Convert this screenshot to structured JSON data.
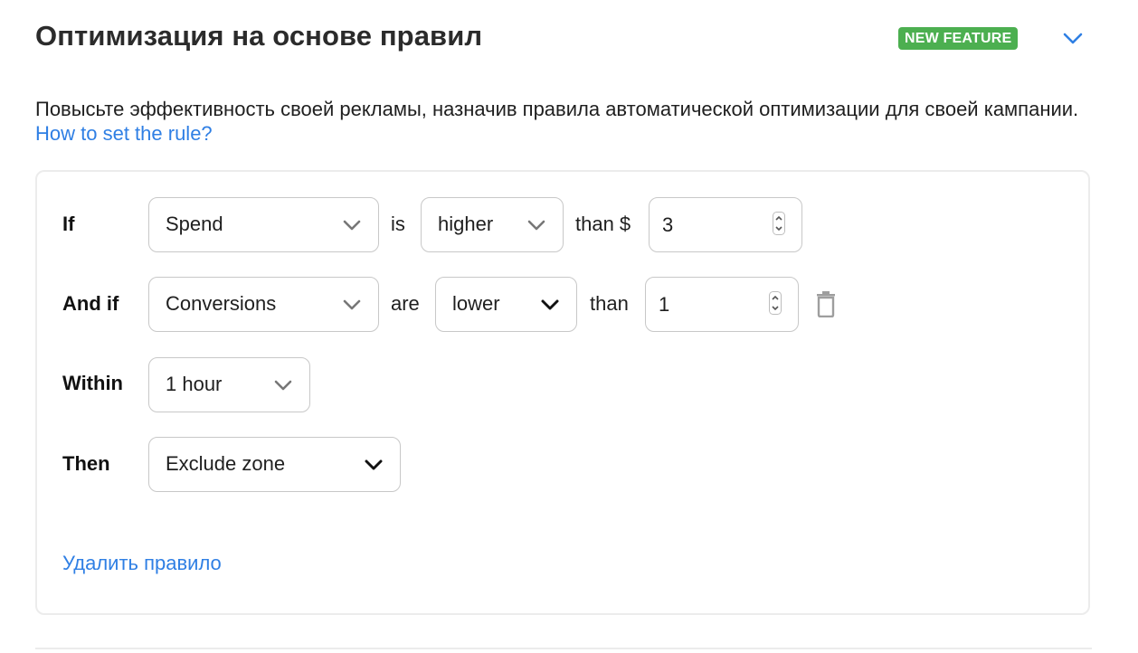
{
  "header": {
    "title": "Оптимизация на основе правил",
    "badge": "NEW FEATURE",
    "collapse_icon": "chevron-down-icon"
  },
  "description": {
    "text": "Повысьте эффективность своей рекламы, назначив правила автоматической оптимизации для своей кампании.",
    "link": "How to set the rule?"
  },
  "rule": {
    "row1": {
      "label": "If",
      "metric": "Spend",
      "verb": "is",
      "comparison": "higher",
      "than": "than $",
      "value": "3"
    },
    "row2": {
      "label": "And if",
      "metric": "Conversions",
      "verb": "are",
      "comparison": "lower",
      "than": "than",
      "value": "1",
      "delete_icon": "trash-icon"
    },
    "row3": {
      "label": "Within",
      "period": "1 hour"
    },
    "row4": {
      "label": "Then",
      "action": "Exclude zone"
    },
    "delete_rule": "Удалить правило"
  },
  "colors": {
    "accent": "#2f7fe4",
    "badge": "#4caf50",
    "border": "#c8c8c8"
  }
}
